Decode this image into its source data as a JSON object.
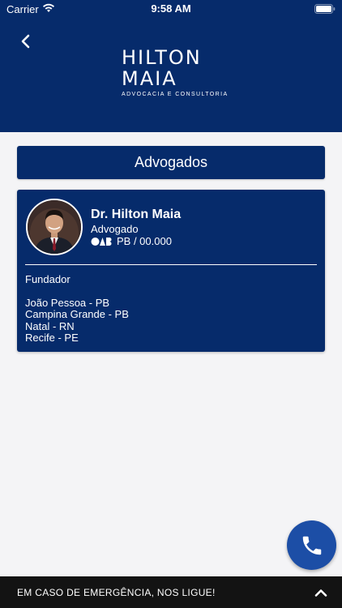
{
  "status_bar": {
    "carrier": "Carrier",
    "time": "9:58 AM"
  },
  "header": {
    "logo": {
      "line1": "HILTON",
      "line2": "MAIA",
      "tagline": "ADVOCACIA E CONSULTORIA"
    }
  },
  "section": {
    "title": "Advogados"
  },
  "lawyer": {
    "name": "Dr. Hilton Maia",
    "role": "Advogado",
    "oab_logo": "OAB",
    "oab_number": "PB / 00.000",
    "position": "Fundador",
    "locations": [
      "João Pessoa - PB",
      "Campina Grande - PB",
      "Natal - RN",
      "Recife - PE"
    ]
  },
  "emergency": {
    "label": "EM CASO DE EMERGÊNCIA, NOS LIGUE!"
  },
  "colors": {
    "primary": "#062b6b",
    "fab": "#1c4ea6",
    "emergency_bar": "#131313",
    "background": "#f4f4f6"
  },
  "icons": {
    "back": "chevron-left-icon",
    "call": "phone-icon",
    "expand": "chevron-up-icon",
    "wifi": "wifi-icon",
    "battery": "battery-icon"
  }
}
